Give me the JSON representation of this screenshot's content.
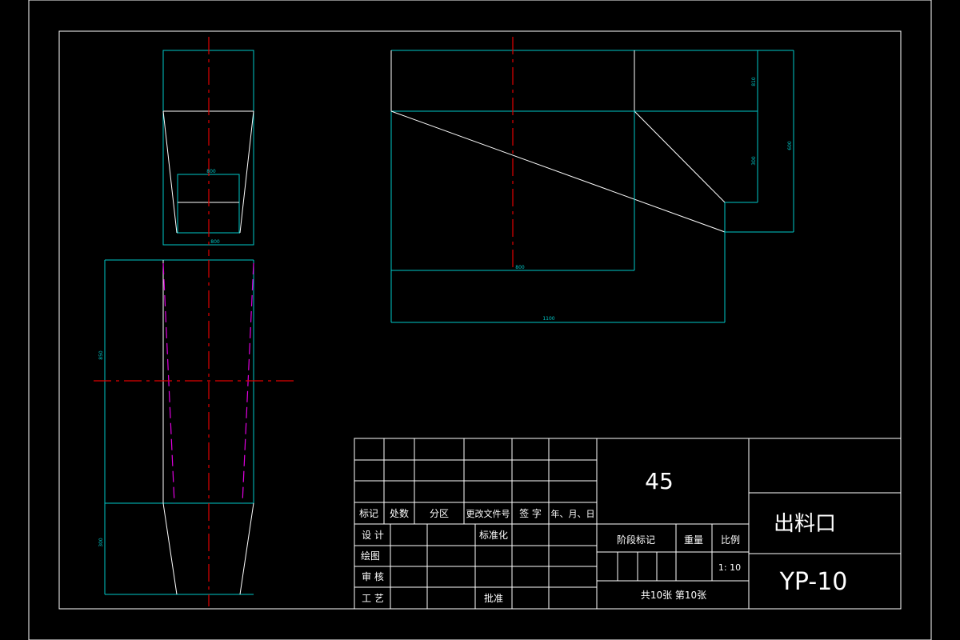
{
  "drawing": {
    "colors": {
      "outline": "#ffffff",
      "dimension": "#00c8c8",
      "centerline": "#e00000",
      "hidden": "#e000e0",
      "background": "#000000"
    },
    "dimensions": {
      "top_view_inner": "800",
      "top_view_outer": "800",
      "side_height_upper": "850",
      "side_height_lower": "300",
      "right_small": "810",
      "right_mid": "300",
      "right_total": "600",
      "right_width_inner": "800",
      "right_width_total": "1100"
    }
  },
  "title_block": {
    "material": "45",
    "part_name": "出料口",
    "drawing_no": "YP-10",
    "headers": [
      "标记",
      "处数",
      "分区",
      "更改文件号",
      "签 字",
      "年、月、日"
    ],
    "labels": {
      "design": "设 计",
      "standardize": "标准化",
      "drawing": "绘图",
      "review": "审 核",
      "process": "工 艺",
      "approve": "批准",
      "stage_mark": "阶段标记",
      "weight": "重量",
      "scale": "比例"
    },
    "scale_value": "1: 10",
    "sheets": "共10张  第10张"
  }
}
